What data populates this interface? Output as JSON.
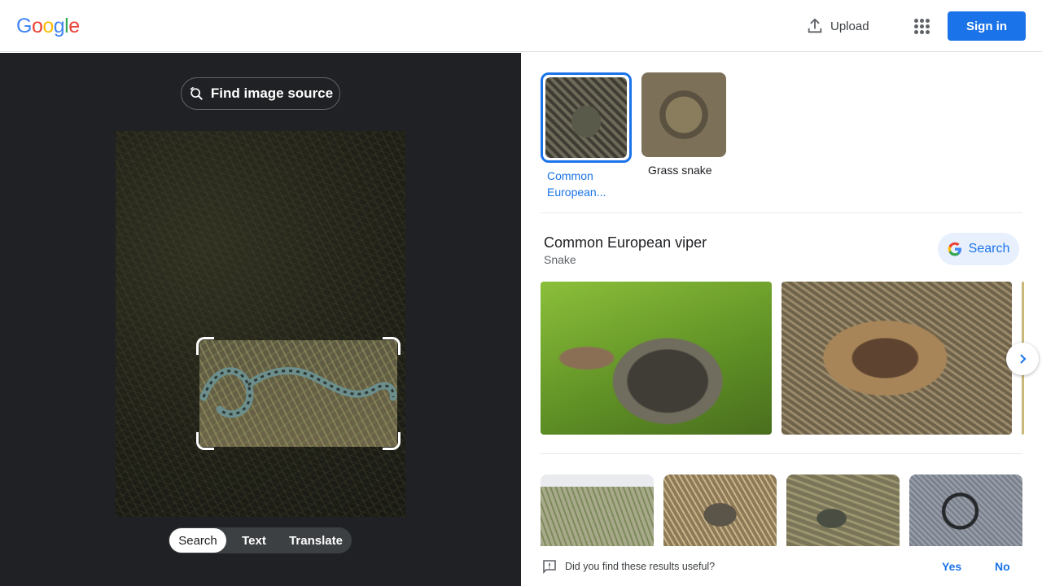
{
  "header": {
    "logo": [
      "G",
      "o",
      "o",
      "g",
      "l",
      "e"
    ],
    "logo_colors": [
      "#4285f4",
      "#ea4335",
      "#fbbc05",
      "#4285f4",
      "#34a853",
      "#ea4335"
    ],
    "upload_label": "Upload",
    "upload_icon": "upload-icon",
    "apps_icon": "apps-grid-icon",
    "signin_label": "Sign in"
  },
  "left_panel": {
    "find_source_label": "Find image source",
    "find_source_icon": "image-search-icon",
    "modes": [
      {
        "label": "Search",
        "active": true
      },
      {
        "label": "Text",
        "active": false
      },
      {
        "label": "Translate",
        "active": false
      }
    ]
  },
  "right_panel": {
    "chips": [
      {
        "label": "Common European...",
        "selected": true
      },
      {
        "label": "Grass snake",
        "selected": false
      }
    ],
    "entity": {
      "title": "Common European viper",
      "subtitle": "Snake",
      "search_label": "Search",
      "search_icon": "google-g-icon"
    },
    "next_icon": "chevron-right-icon",
    "feedback": {
      "question": "Did you find these results useful?",
      "icon": "feedback-icon",
      "yes": "Yes",
      "no": "No"
    }
  },
  "colors": {
    "accent": "#1a73e8",
    "dark_panel": "#202124",
    "mode_bar": "#3c4043"
  }
}
